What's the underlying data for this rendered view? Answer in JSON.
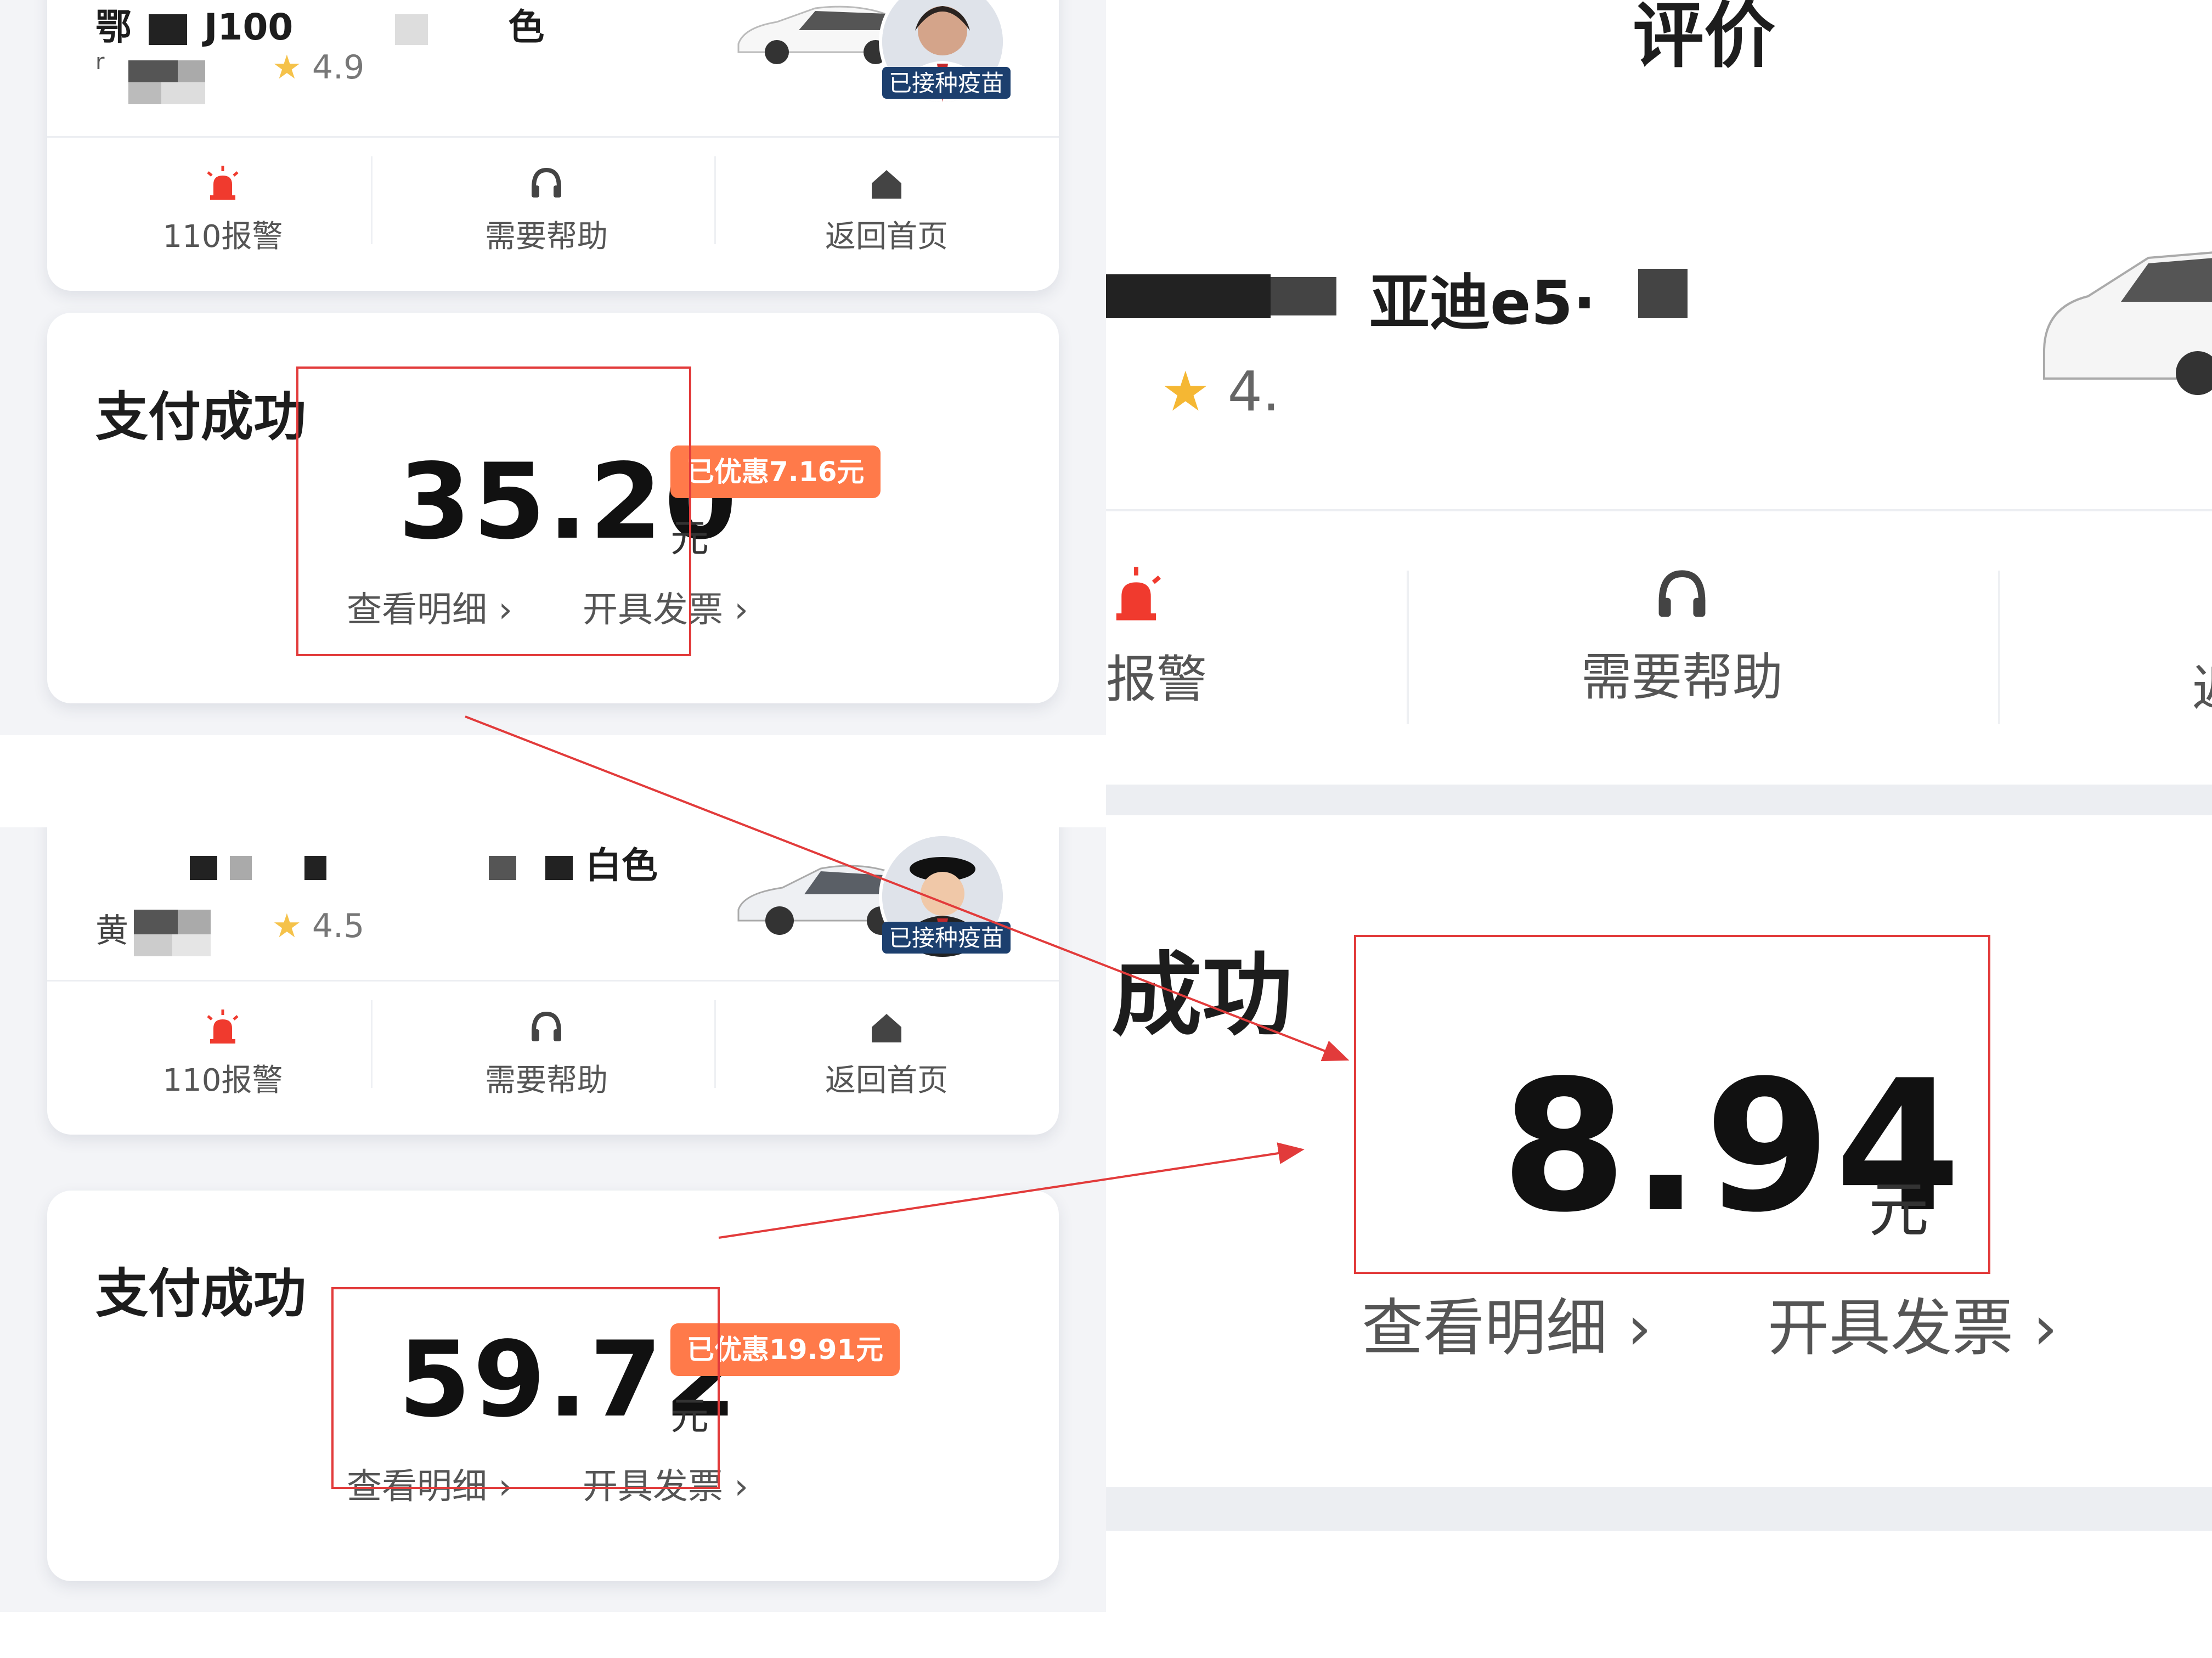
{
  "top_screen": {
    "driver_name_fragment_a": "鄂",
    "driver_name_fragment_b": "J100",
    "driver_name_fragment_c": "色",
    "rating_prefix": "r",
    "rating": "4.9",
    "vaccine_badge": "已接种疫苗",
    "actions": [
      "110报警",
      "需要帮助",
      "返回首页"
    ],
    "pay_title": "支付成功",
    "amount": "35.20",
    "currency": "元",
    "discount": "已优惠7.16元",
    "detail_link": "查看明细 ›",
    "invoice_link": "开具发票 ›"
  },
  "bottom_screen": {
    "driver_name_fragment": "白色",
    "rating_prefix": "黄",
    "rating": "4.5",
    "vaccine_badge": "已接种疫苗",
    "actions": [
      "110报警",
      "需要帮助",
      "返回首页"
    ],
    "pay_title": "支付成功",
    "amount": "59.72",
    "currency": "元",
    "discount": "已优惠19.91元",
    "detail_link": "查看明细 ›",
    "invoice_link": "开具发票 ›"
  },
  "right_screen": {
    "header": "评价",
    "car_model": "亚迪e5·",
    "rating": "4.",
    "actions": [
      "报警",
      "需要帮助",
      "返"
    ],
    "pay_title": "成功",
    "amount": "8.94",
    "currency": "元",
    "detail_link": "查看明细 ›",
    "invoice_link": "开具发票 ›"
  },
  "colors": {
    "annotation_red": "#e23b3b",
    "discount_orange": "#ff7a4a",
    "badge_navy": "#1c3f6e",
    "alarm_red": "#f03a2e"
  }
}
